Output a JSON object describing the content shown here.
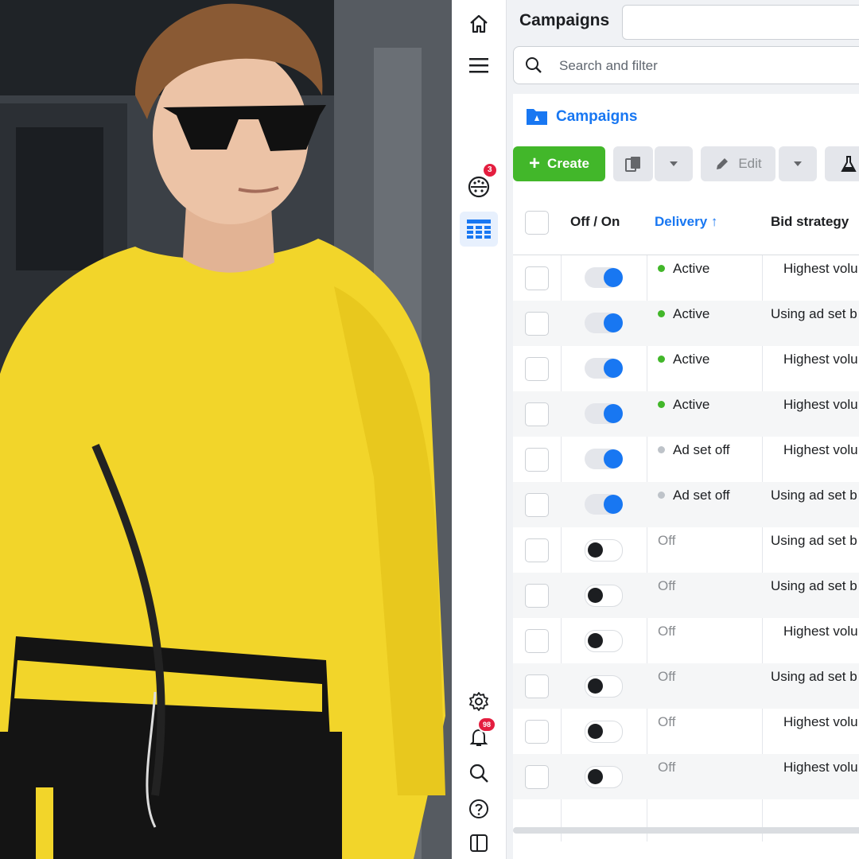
{
  "nav": {
    "items": [
      {
        "icon": "home-icon"
      },
      {
        "icon": "menu-icon"
      },
      {
        "icon": "campaign-planner-icon",
        "badge": "3"
      },
      {
        "icon": "ads-manager-table-icon",
        "active": true
      }
    ],
    "bottom": [
      {
        "icon": "settings-icon"
      },
      {
        "icon": "notifications-icon",
        "badge": "98"
      },
      {
        "icon": "search-icon"
      },
      {
        "icon": "help-icon"
      },
      {
        "icon": "sidebar-toggle-icon"
      }
    ]
  },
  "header": {
    "title": "Campaigns"
  },
  "search": {
    "placeholder": "Search and filter"
  },
  "panel": {
    "tab_label": "Campaigns"
  },
  "toolbar": {
    "create_label": "Create",
    "edit_label": "Edit"
  },
  "table": {
    "columns": [
      {
        "label": "Off / On"
      },
      {
        "label": "Delivery ↑",
        "sorted": true
      },
      {
        "label": "Bid strategy"
      }
    ],
    "rows": [
      {
        "on": true,
        "delivery": "Active",
        "status": "active",
        "bid": "Highest volu"
      },
      {
        "on": true,
        "delivery": "Active",
        "status": "active",
        "bid": "Using ad set b"
      },
      {
        "on": true,
        "delivery": "Active",
        "status": "active",
        "bid": "Highest volu"
      },
      {
        "on": true,
        "delivery": "Active",
        "status": "active",
        "bid": "Highest volu"
      },
      {
        "on": true,
        "delivery": "Ad set off",
        "status": "adsetoff",
        "bid": "Highest volu"
      },
      {
        "on": true,
        "delivery": "Ad set off",
        "status": "adsetoff",
        "bid": "Using ad set b"
      },
      {
        "on": false,
        "delivery": "Off",
        "status": "off",
        "bid": "Using ad set b"
      },
      {
        "on": false,
        "delivery": "Off",
        "status": "off",
        "bid": "Using ad set b"
      },
      {
        "on": false,
        "delivery": "Off",
        "status": "off",
        "bid": "Highest volu"
      },
      {
        "on": false,
        "delivery": "Off",
        "status": "off",
        "bid": "Using ad set b"
      },
      {
        "on": false,
        "delivery": "Off",
        "status": "off",
        "bid": "Highest volu"
      },
      {
        "on": false,
        "delivery": "Off",
        "status": "off",
        "bid": "Highest volu"
      }
    ]
  },
  "colors": {
    "accent": "#1877f2",
    "create": "#42b72a",
    "active_dot": "#42b72a",
    "off_dot": "#bec3c9",
    "badge": "#e41e3f"
  },
  "photo": {
    "subject": "man-in-yellow-sweater"
  }
}
